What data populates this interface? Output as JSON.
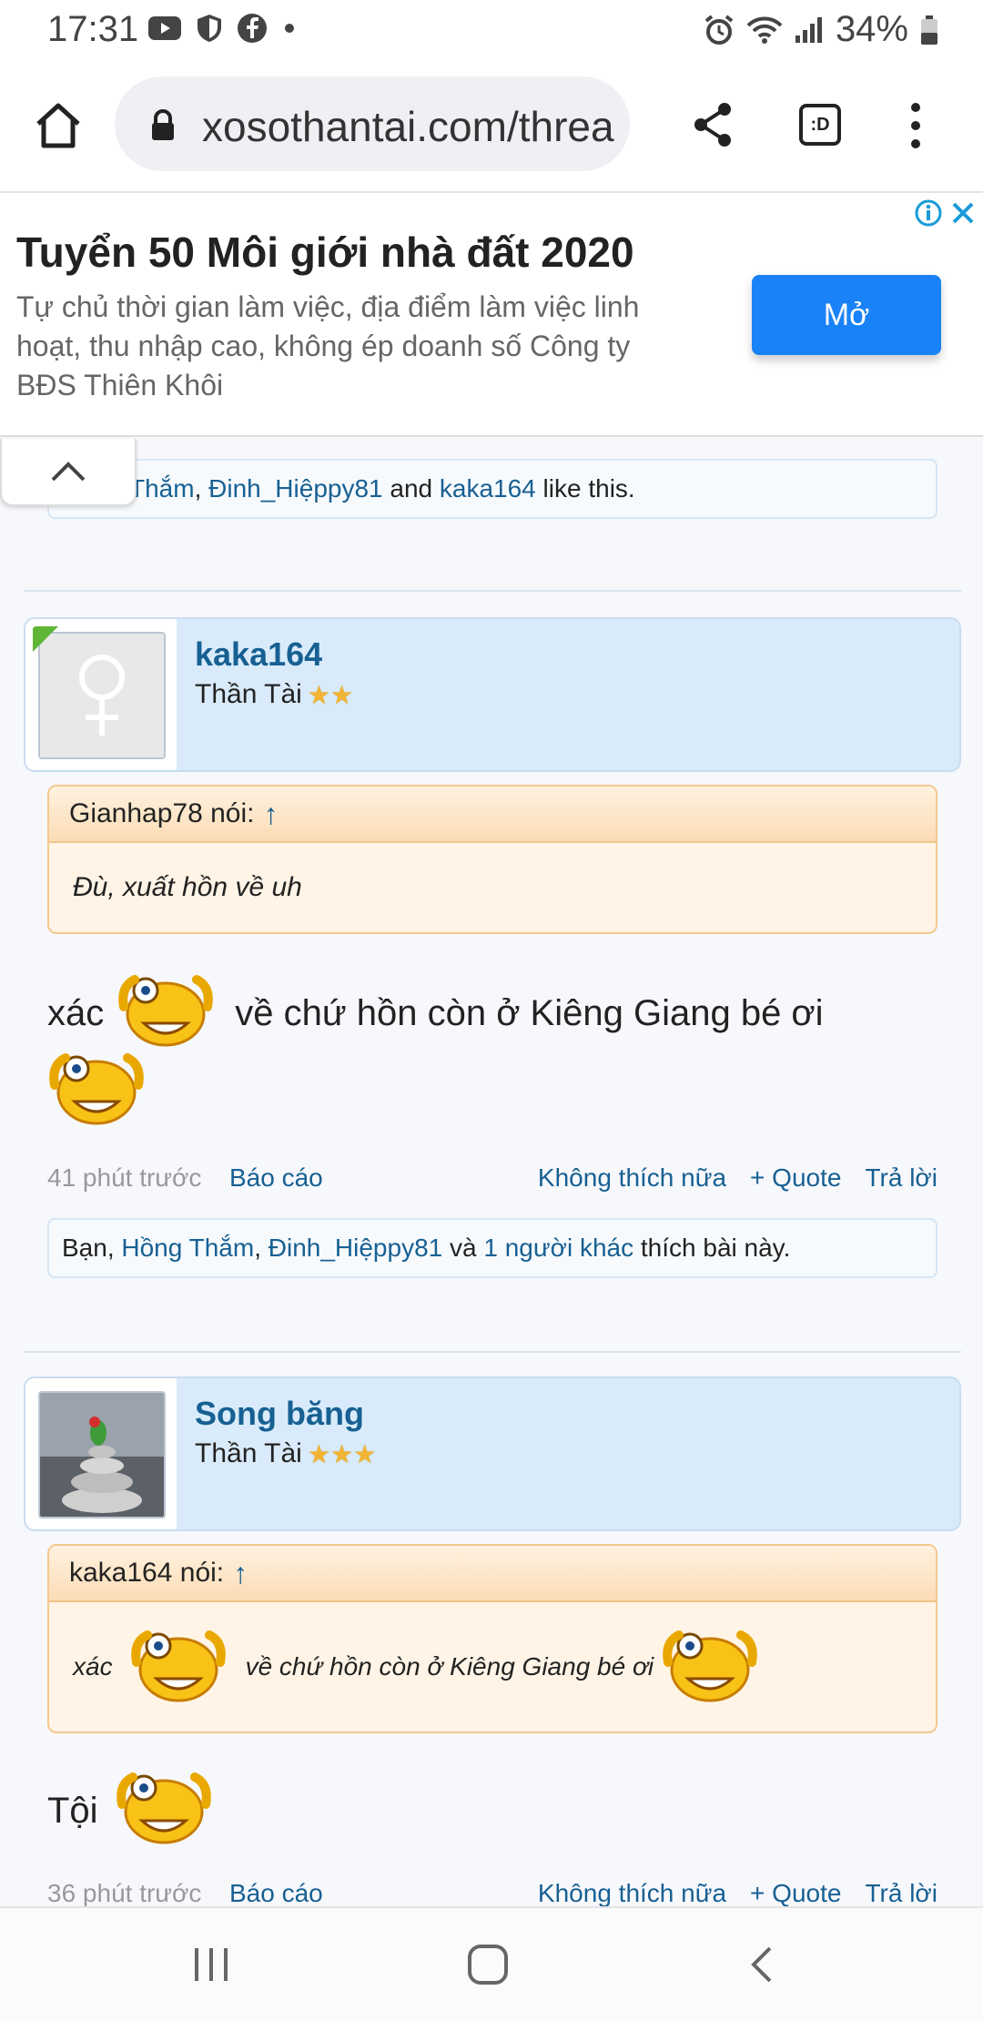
{
  "status_bar": {
    "time": "17:31",
    "battery": "34%"
  },
  "browser": {
    "url": "xosothantai.com/threa"
  },
  "ad": {
    "title": "Tuyển 50 Môi giới nhà đất 2020",
    "description": "Tự chủ thời gian làm việc, địa điểm làm việc linh hoạt, thu nhập cao, không ép doanh số Công ty BĐS Thiên Khôi",
    "open_label": "Mở"
  },
  "top_likes": {
    "name1": "Thắm",
    "name2": "Đinh_Hiệppy81",
    "and": "and",
    "name3": "kaka164",
    "suffix": "like this."
  },
  "post1": {
    "username": "kaka164",
    "user_title": "Thần Tài",
    "stars": "★★",
    "quote_author": "Gianhap78 nói:",
    "quote_arrow": "↑",
    "quote_text": "Đù, xuất hồn về uh",
    "msg_word1": "xác",
    "msg_word2": "về chứ hồn còn ở Kiêng Giang bé ơi",
    "time": "41 phút trước",
    "report": "Báo cáo",
    "unlike": "Không thích nữa",
    "quote_btn": "+ Quote",
    "reply": "Trả lời",
    "likes": {
      "prefix": "Bạn,",
      "name1": "Hồng Thắm",
      "comma": ",",
      "name2": "Đinh_Hiệppy81",
      "and": "và",
      "others": "1 người khác",
      "suffix": "thích bài này."
    }
  },
  "post2": {
    "username": "Song băng",
    "user_title": "Thần Tài",
    "stars": "★★★",
    "quote_author": "kaka164 nói:",
    "quote_arrow": "↑",
    "quote_word1": "xác",
    "quote_word2": "về chứ hồn còn ở Kiêng Giang bé ơi",
    "msg": "Tội",
    "time": "36 phút trước",
    "report": "Báo cáo",
    "unlike": "Không thích nữa",
    "quote_btn": "+ Quote",
    "reply": "Trả lời"
  }
}
